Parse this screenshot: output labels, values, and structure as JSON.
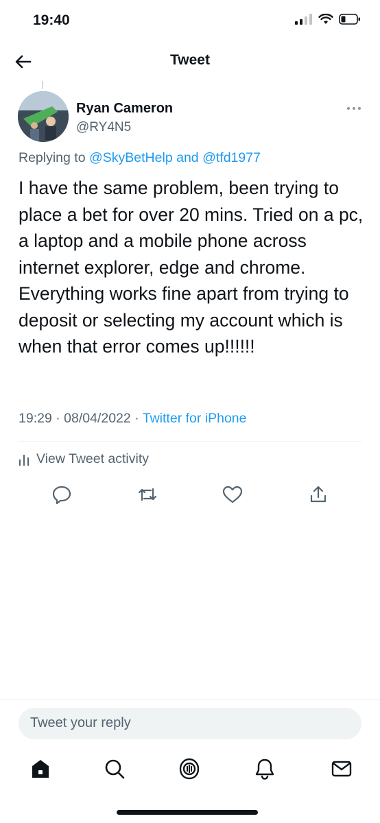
{
  "status_bar": {
    "time": "19:40"
  },
  "header": {
    "title": "Tweet"
  },
  "tweet": {
    "author_name": "Ryan Cameron",
    "author_handle": "@RY4N5",
    "replying_prefix": "Replying to",
    "reply_to_1": "@SkyBetHelp",
    "reply_conj": "and",
    "reply_to_2": "@tfd1977",
    "text": "I have the same problem, been trying to place a bet for over 20 mins. Tried on a pc, a laptop and a mobile phone across internet explorer, edge and chrome. Everything works fine apart from trying to deposit or selecting my account which is when that error comes up!!!!!!",
    "time": "19:29",
    "date": "08/04/2022",
    "sep": "·",
    "source": "Twitter for iPhone",
    "activity_label": "View Tweet activity"
  },
  "reply_bar": {
    "placeholder": "Tweet your reply"
  },
  "colors": {
    "accent": "#1d9bf0",
    "text": "#0f1419",
    "muted": "#536471"
  },
  "icons": {
    "actions": [
      "reply-icon",
      "retweet-icon",
      "like-icon",
      "share-icon"
    ],
    "nav": [
      "home-icon",
      "search-icon",
      "spaces-icon",
      "notifications-icon",
      "messages-icon"
    ]
  }
}
